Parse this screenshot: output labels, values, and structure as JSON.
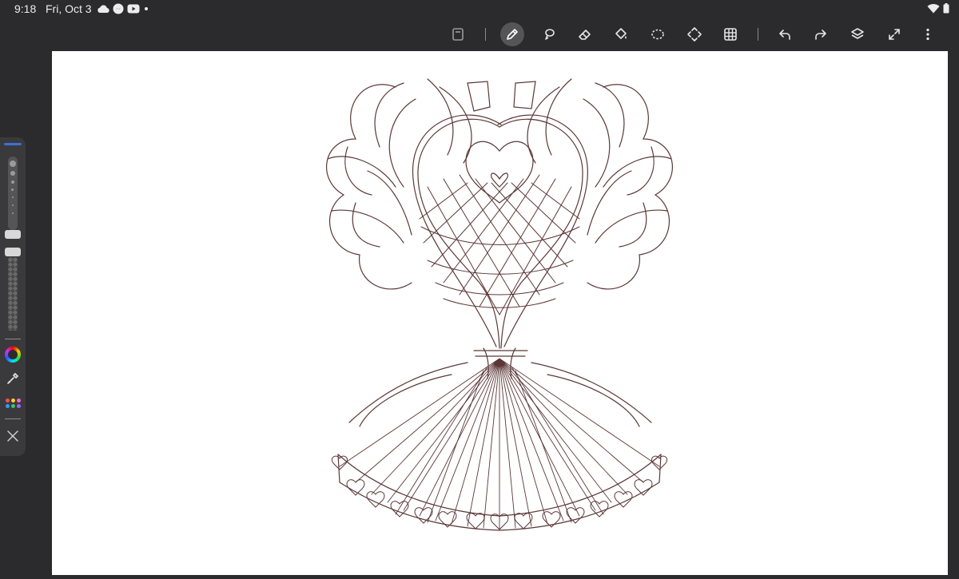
{
  "status_bar": {
    "time": "9:18",
    "date": "Fri, Oct 3",
    "notification_icons": [
      "cloud-icon",
      "messenger-icon",
      "youtube-icon",
      "dot-icon"
    ],
    "system_icons": [
      "wifi-icon",
      "battery-icon"
    ]
  },
  "toolbar": {
    "tools": [
      "save-icon",
      "pencil-icon",
      "lasso-pen-icon",
      "eraser-icon",
      "fill-bucket-icon",
      "selection-icon",
      "transform-icon",
      "grid-icon",
      "undo-icon",
      "redo-icon",
      "layers-icon",
      "fullscreen-icon",
      "more-icon"
    ],
    "active_tool": "pencil"
  },
  "left_panel": {
    "controls": [
      "brush-size-slider",
      "opacity-slider",
      "color-wheel-icon",
      "eyedropper-icon",
      "palette-icon",
      "close-icon"
    ]
  },
  "canvas": {
    "background": "#ffffff",
    "stroke_color": "#4a2222",
    "content": "sketch-artwork"
  },
  "colors": {
    "chrome": "#2b2b2d",
    "panel": "#3a3a3c",
    "accent": "#3d6fd6"
  }
}
